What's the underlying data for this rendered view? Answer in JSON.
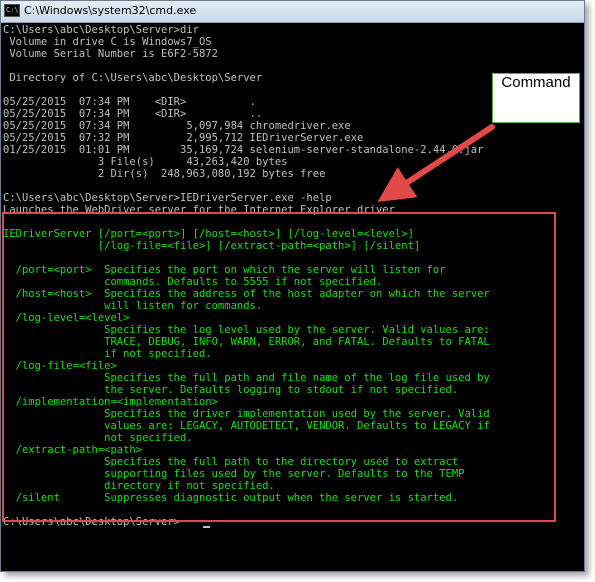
{
  "window": {
    "title": "C:\\Windows\\system32\\cmd.exe",
    "icon_label": "C:\\"
  },
  "console": {
    "lines": [
      {
        "text": "C:\\Users\\abc\\Desktop\\Server>dir",
        "color": "#c0c0c0"
      },
      {
        "text": " Volume in drive C is Windows7_OS",
        "color": "#c0c0c0"
      },
      {
        "text": " Volume Serial Number is E6F2-5872",
        "color": "#c0c0c0"
      },
      {
        "text": "",
        "color": "#c0c0c0"
      },
      {
        "text": " Directory of C:\\Users\\abc\\Desktop\\Server",
        "color": "#c0c0c0"
      },
      {
        "text": "",
        "color": "#c0c0c0"
      },
      {
        "text": "05/25/2015  07:34 PM    <DIR>          .",
        "color": "#c0c0c0"
      },
      {
        "text": "05/25/2015  07:34 PM    <DIR>          ..",
        "color": "#c0c0c0"
      },
      {
        "text": "05/25/2015  07:34 PM         5,097,984 chromedriver.exe",
        "color": "#c0c0c0"
      },
      {
        "text": "05/25/2015  07:32 PM         2,995,712 IEDriverServer.exe",
        "color": "#c0c0c0"
      },
      {
        "text": "01/25/2015  01:01 PM        35,169,724 selenium-server-standalone-2.44.0.jar",
        "color": "#c0c0c0"
      },
      {
        "text": "               3 File(s)     43,263,420 bytes",
        "color": "#c0c0c0"
      },
      {
        "text": "               2 Dir(s)  248,963,080,192 bytes free",
        "color": "#c0c0c0"
      },
      {
        "text": "",
        "color": "#c0c0c0"
      },
      {
        "text": "C:\\Users\\abc\\Desktop\\Server>IEDriverServer.exe -help",
        "color": "#c0c0c0"
      },
      {
        "text": "Launches the WebDriver server for the Internet Explorer driver",
        "color": "#c0c0c0"
      },
      {
        "text": "",
        "color": "#18e014"
      },
      {
        "text": "IEDriverServer [/port=<port>] [/host=<host>] [/log-level=<level>]",
        "color": "#18e014"
      },
      {
        "text": "               [/log-file=<file>] [/extract-path=<path>] [/silent]",
        "color": "#18e014"
      },
      {
        "text": "",
        "color": "#18e014"
      },
      {
        "text": "  /port=<port>  Specifies the port on which the server will listen for",
        "color": "#18e014"
      },
      {
        "text": "                commands. Defaults to 5555 if not specified.",
        "color": "#18e014"
      },
      {
        "text": "  /host=<host>  Specifies the address of the host adapter on which the server",
        "color": "#18e014"
      },
      {
        "text": "                will listen for commands.",
        "color": "#18e014"
      },
      {
        "text": "  /log-level=<level>",
        "color": "#18e014"
      },
      {
        "text": "                Specifies the log level used by the server. Valid values are:",
        "color": "#18e014"
      },
      {
        "text": "                TRACE, DEBUG, INFO, WARN, ERROR, and FATAL. Defaults to FATAL",
        "color": "#18e014"
      },
      {
        "text": "                if not specified.",
        "color": "#18e014"
      },
      {
        "text": "  /log-file=<file>",
        "color": "#18e014"
      },
      {
        "text": "                Specifies the full path and file name of the log file used by",
        "color": "#18e014"
      },
      {
        "text": "                the server. Defaults logging to stdout if not specified.",
        "color": "#18e014"
      },
      {
        "text": "  /implementation=<implementation>",
        "color": "#18e014"
      },
      {
        "text": "                Specifies the driver implementation used by the server. Valid",
        "color": "#18e014"
      },
      {
        "text": "                values are: LEGACY, AUTODETECT, VENDOR. Defaults to LEGACY if",
        "color": "#18e014"
      },
      {
        "text": "                not specified.",
        "color": "#18e014"
      },
      {
        "text": "  /extract-path=<path>",
        "color": "#18e014"
      },
      {
        "text": "                Specifies the full path to the directory used to extract",
        "color": "#18e014"
      },
      {
        "text": "                supporting files used by the server. Defaults to the TEMP",
        "color": "#18e014"
      },
      {
        "text": "                directory if not specified.",
        "color": "#18e014"
      },
      {
        "text": "  /silent       Suppresses diagnostic output when the server is started.",
        "color": "#18e014"
      },
      {
        "text": "",
        "color": "#c0c0c0"
      },
      {
        "text": "C:\\Users\\abc\\Desktop\\Server>",
        "color": "#c0c0c0"
      }
    ]
  },
  "annotation": {
    "label": "Command",
    "arrow_color": "#e24a4a",
    "box_color": "#e24a4a",
    "callout_border_color": "#57b437"
  }
}
